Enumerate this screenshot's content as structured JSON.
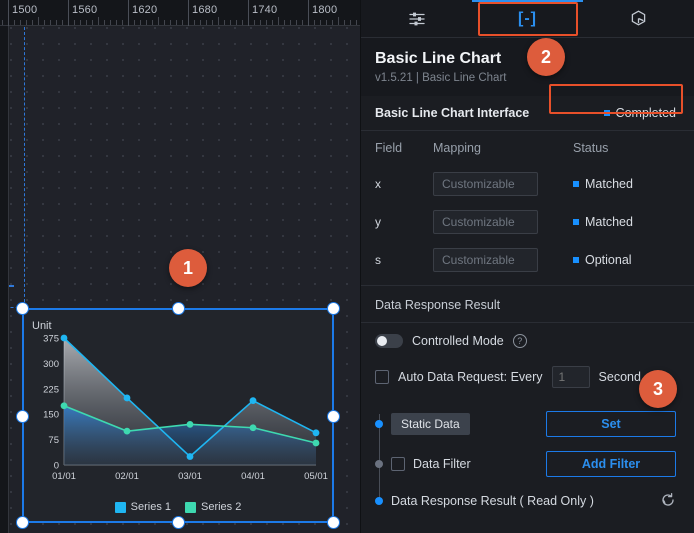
{
  "canvas": {
    "ruler": {
      "labels": [
        "1500",
        "1560",
        "1620",
        "1680",
        "1740",
        "1800"
      ]
    },
    "annotations": [
      {
        "id": "1",
        "label": "1"
      },
      {
        "id": "2",
        "label": "2"
      },
      {
        "id": "3",
        "label": "3"
      }
    ]
  },
  "chart_data": {
    "type": "line",
    "title": "",
    "ylabel": "Unit",
    "xlabel": "",
    "categories": [
      "01/01",
      "02/01",
      "03/01",
      "04/01",
      "05/01"
    ],
    "yticks": [
      "0",
      "75",
      "150",
      "225",
      "300",
      "375"
    ],
    "ylim": [
      0,
      375
    ],
    "grid": false,
    "legend_position": "bottom",
    "series": [
      {
        "name": "Series 1",
        "color": "#1fb6f2",
        "values": [
          375,
          198,
          25,
          190,
          95
        ]
      },
      {
        "name": "Series 2",
        "color": "#3ed9b0",
        "values": [
          175,
          100,
          120,
          110,
          65
        ]
      }
    ]
  },
  "panel": {
    "tabs": [
      {
        "name": "settings",
        "icon": "sliders-icon",
        "label": "",
        "active": false
      },
      {
        "name": "data",
        "icon": "brackets-icon",
        "label": "[-]",
        "active": true
      },
      {
        "name": "events",
        "icon": "event-icon",
        "label": "",
        "active": false
      }
    ],
    "header": {
      "title": "Basic Line Chart",
      "subtitle": "v1.5.21 | Basic Line Chart"
    },
    "interface": {
      "name": "Basic Line Chart Interface",
      "status": "Completed"
    },
    "table": {
      "columns": [
        "Field",
        "Mapping",
        "Status"
      ],
      "rows": [
        {
          "field": "x",
          "mapping_value": "",
          "mapping_placeholder": "Customizable",
          "status": "Matched"
        },
        {
          "field": "y",
          "mapping_value": "",
          "mapping_placeholder": "Customizable",
          "status": "Matched"
        },
        {
          "field": "s",
          "mapping_value": "",
          "mapping_placeholder": "Customizable",
          "status": "Optional"
        }
      ]
    },
    "data_response": {
      "section_title": "Data Response Result",
      "controlled_mode": {
        "label": "Controlled Mode",
        "help": "?",
        "on": false
      },
      "auto_request": {
        "label": "Auto Data Request: Every",
        "value": "1",
        "placeholder": "1",
        "unit": "Second",
        "checked": false
      },
      "timeline": {
        "static_data": {
          "chip": "Static Data",
          "button": "Set"
        },
        "data_filter": {
          "label": "Data Filter",
          "button": "Add Filter",
          "checked": false
        },
        "result": {
          "label": "Data Response Result ( Read Only )",
          "icon": "refresh-icon"
        }
      }
    }
  },
  "colors": {
    "accent": "#1c7ae8",
    "highlight": "#e8502a",
    "badge": "#dd5c3c",
    "series1": "#1fb6f2",
    "series2": "#3ed9b0"
  }
}
